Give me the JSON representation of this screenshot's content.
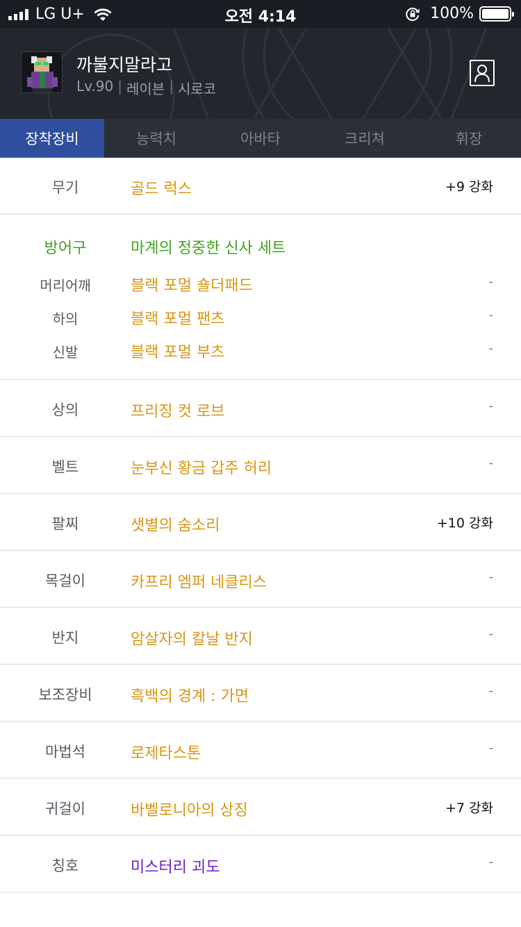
{
  "status_bar": {
    "carrier": "LG U+",
    "time": "오전 4:14",
    "battery": "100%"
  },
  "profile": {
    "name": "까불지말라고",
    "level": "Lv.90",
    "class": "레이븐",
    "server": "시로코",
    "separator": "|"
  },
  "tabs": [
    {
      "label": "장착장비",
      "active": true
    },
    {
      "label": "능력치",
      "active": false
    },
    {
      "label": "아바타",
      "active": false
    },
    {
      "label": "크리쳐",
      "active": false
    },
    {
      "label": "휘장",
      "active": false
    }
  ],
  "equipment": {
    "weapon": {
      "slot": "무기",
      "item": "골드 럭스",
      "enhance": "+9 강화"
    },
    "armor_set": {
      "slot": "방어구",
      "set_name": "마계의 정중한 신사 세트",
      "pieces": [
        {
          "slot": "머리어깨",
          "item": "블랙 포멀 숄더패드",
          "enhance": "-"
        },
        {
          "slot": "하의",
          "item": "블랙 포멀 팬츠",
          "enhance": "-"
        },
        {
          "slot": "신발",
          "item": "블랙 포멀 부츠",
          "enhance": "-"
        }
      ]
    },
    "rows": [
      {
        "slot": "상의",
        "item": "프리징 컷 로브",
        "enhance": "-"
      },
      {
        "slot": "벨트",
        "item": "눈부신 황금 갑주 허리",
        "enhance": "-"
      },
      {
        "slot": "팔찌",
        "item": "샛별의 숨소리",
        "enhance": "+10 강화"
      },
      {
        "slot": "목걸이",
        "item": "카프리 엠퍼 네클리스",
        "enhance": "-"
      },
      {
        "slot": "반지",
        "item": "암살자의 칼날 반지",
        "enhance": "-"
      },
      {
        "slot": "보조장비",
        "item": "흑백의 경계 : 가면",
        "enhance": "-"
      },
      {
        "slot": "마법석",
        "item": "로제타스톤",
        "enhance": "-"
      },
      {
        "slot": "귀걸이",
        "item": "바벨로니아의 상징",
        "enhance": "+7 강화"
      },
      {
        "slot": "칭호",
        "item": "미스터리 괴도",
        "enhance": "-"
      }
    ]
  },
  "colors": {
    "unique_item": "#d89614",
    "set_item": "#42a221",
    "title_item": "#6a1cc4",
    "tab_active": "#2f4f9e"
  },
  "icons": [
    "signal-icon",
    "wifi-icon",
    "rotation-lock-icon",
    "battery-icon",
    "character-avatar",
    "profile-icon"
  ]
}
